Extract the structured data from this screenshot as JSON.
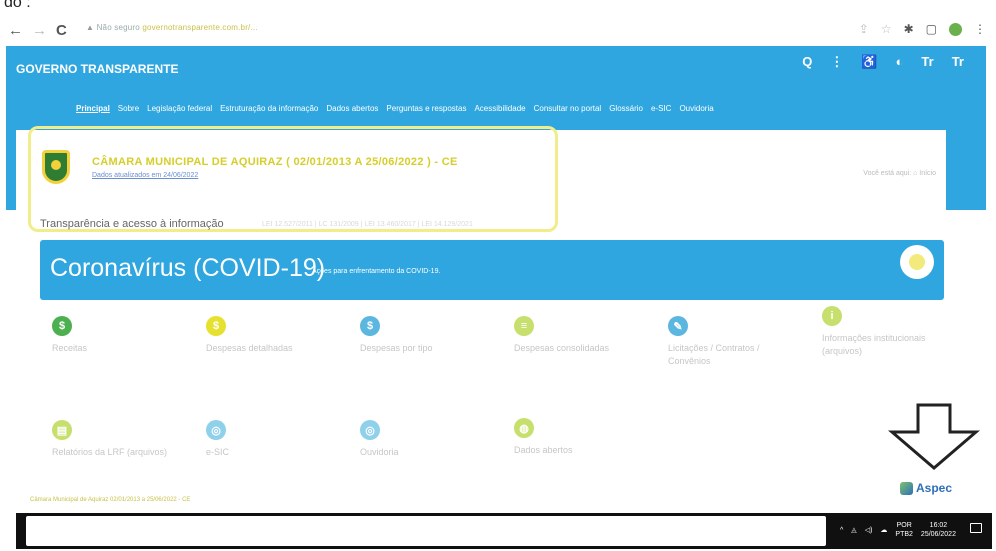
{
  "document": {
    "leading_text": "do :"
  },
  "browser": {
    "address": "Não seguro",
    "url": "governotransparente.com.br/...",
    "icons": [
      "back-icon",
      "forward-icon",
      "reload-icon",
      "warning-icon",
      "share-icon",
      "star-icon",
      "extensions-icon",
      "window-icon",
      "profile-icon",
      "menu-icon"
    ]
  },
  "header": {
    "brand": "GOVERNO TRANSPARENTE",
    "icons": {
      "search": "Q",
      "more": "⋮",
      "accessibility": "♿",
      "contrast": "◐",
      "font_down": "Tr",
      "font_up": "Tr"
    },
    "menu": [
      "Principal",
      "Sobre",
      "Legislação federal",
      "Estruturação da informação",
      "Dados abertos",
      "Perguntas e respostas",
      "Acessibilidade",
      "Consultar no portal",
      "Glossário",
      "e-SIC",
      "Ouvidoria"
    ]
  },
  "entity": {
    "name": "CÂMARA MUNICIPAL DE AQUIRAZ ( 02/01/2013 A 25/06/2022 ) - CE",
    "subtitle": "Dados atualizados em 24/06/2022",
    "breadcrumb": "Você está aqui: ⌂ Início",
    "transparency_label": "Transparência e acesso à informação",
    "transparency_extra": "LEI 12.527/2011 | LC 131/2009 | LEI 13.460/2017 | LEI 14.129/2021"
  },
  "covid": {
    "title": "Coronavírus (COVID-19)",
    "subtitle": "Ações para enfrentamento da COVID-19."
  },
  "tiles": [
    {
      "label": "Receitas",
      "icon": "dollar-icon",
      "glyph": "$",
      "color": "#4caf50"
    },
    {
      "label": "Despesas detalhadas",
      "icon": "coin-icon",
      "glyph": "$",
      "color": "#e6e12e"
    },
    {
      "label": "Despesas por tipo",
      "icon": "money-icon",
      "glyph": "$",
      "color": "#5bb6e0"
    },
    {
      "label": "Despesas consolidadas",
      "icon": "list-icon",
      "glyph": "≡",
      "color": "#c6df6d"
    },
    {
      "label": "Licitações / Contratos / Convênios",
      "icon": "pencil-icon",
      "glyph": "✎",
      "color": "#5bb6e0"
    },
    {
      "label": "Informações institucionais (arquivos)",
      "icon": "info-icon",
      "glyph": "i",
      "color": "#c6df6d"
    },
    {
      "label": "Relatórios da LRF (arquivos)",
      "icon": "report-icon",
      "glyph": "▤",
      "color": "#c6df6d"
    },
    {
      "label": "e-SIC",
      "icon": "esic-icon",
      "glyph": "◎",
      "color": "#8fd0ea"
    },
    {
      "label": "Ouvidoria",
      "icon": "ouvidoria-icon",
      "glyph": "◎",
      "color": "#8fd0ea"
    },
    {
      "label": "Dados abertos",
      "icon": "data-icon",
      "glyph": "◍",
      "color": "#c6df6d"
    }
  ],
  "footer": {
    "note": "Câmara Municipal de Aquiraz 02/01/2013 a 25/06/2022 - CE",
    "vendor": "Aspec"
  },
  "taskbar": {
    "lang_top": "POR",
    "lang_bottom": "PTB2",
    "time": "16:02",
    "date": "25/06/2022"
  }
}
